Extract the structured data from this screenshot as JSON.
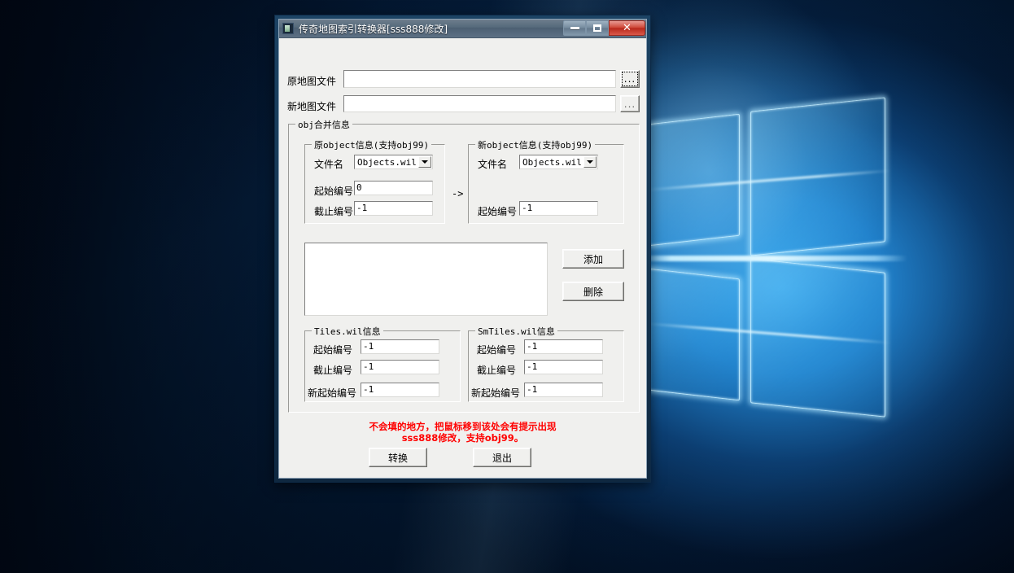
{
  "window": {
    "title": "传奇地图索引转换器[sss888修改]",
    "icon": "app-icon",
    "buttons": {
      "minimize": "minimize-icon",
      "maximize": "maximize-icon",
      "close": "✕"
    }
  },
  "files": {
    "original_label": "原地图文件",
    "original_value": "",
    "original_browse": "...",
    "new_label": "新地图文件",
    "new_value": "",
    "new_browse": "..."
  },
  "obj_group": {
    "title": "obj合并信息",
    "arrow": "->",
    "source": {
      "title": "原object信息(支持obj99)",
      "filename_label": "文件名",
      "filename_value": "Objects.wil",
      "start_label": "起始编号",
      "start_value": "0",
      "end_label": "截止编号",
      "end_value": "-1"
    },
    "target": {
      "title": "新object信息(支持obj99)",
      "filename_label": "文件名",
      "filename_value": "Objects.wil",
      "start_label": "起始编号",
      "start_value": "-1"
    },
    "list_items": [],
    "add_button": "添加",
    "delete_button": "删除"
  },
  "tiles": {
    "title": "Tiles.wil信息",
    "start_label": "起始编号",
    "start_value": "-1",
    "end_label": "截止编号",
    "end_value": "-1",
    "newstart_label": "新起始编号",
    "newstart_value": "-1"
  },
  "smtiles": {
    "title": "SmTiles.wil信息",
    "start_label": "起始编号",
    "start_value": "-1",
    "end_label": "截止编号",
    "end_value": "-1",
    "newstart_label": "新起始编号",
    "newstart_value": "-1"
  },
  "footer": {
    "warning_line1": "不会填的地方，把鼠标移到该处会有提示出现",
    "warning_line2": "sss888修改，支持obj99。",
    "convert_button": "转换",
    "exit_button": "退出",
    "warning_color": "#ff0000"
  }
}
